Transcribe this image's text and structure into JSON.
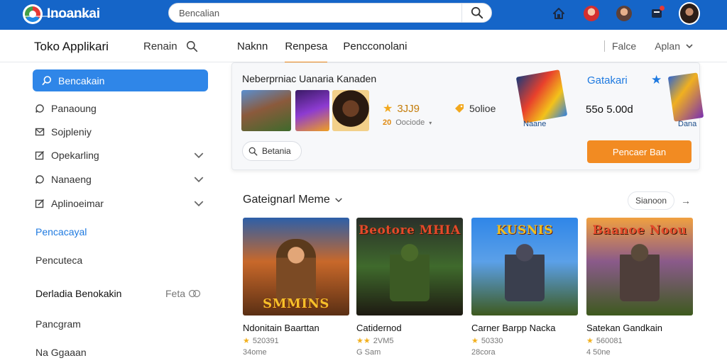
{
  "topbar": {
    "brand": "Inoankai",
    "search_placeholder": "Bencalian",
    "accent": "#1565c8"
  },
  "subbar": {
    "store_title": "Toko Applikari",
    "search_label": "Renain",
    "tabs": [
      {
        "label": "Naknn",
        "active": false
      },
      {
        "label": "Renpesa",
        "active": true
      },
      {
        "label": "Pencconolani",
        "active": false
      }
    ],
    "right_a": "Falce",
    "right_b": "Aplan"
  },
  "sidebar": {
    "active_item": {
      "label": "Bencakain",
      "icon": "search-icon"
    },
    "items": [
      {
        "label": "Panaoung",
        "icon": "chat-icon",
        "has_chevron": false
      },
      {
        "label": "Sojpleniy",
        "icon": "mail-icon",
        "has_chevron": false
      },
      {
        "label": "Opekarling",
        "icon": "edit-icon",
        "has_chevron": true
      },
      {
        "label": "Nanaeng",
        "icon": "chat-icon",
        "has_chevron": true
      },
      {
        "label": "Aplinoeimar",
        "icon": "edit-icon",
        "has_chevron": true
      }
    ],
    "section_blue": "Pencacayal",
    "section_plain": "Pencuteca",
    "row_left": "Derladia Benokakin",
    "row_right": "Feta",
    "tail_1": "Pancgram",
    "tail_2": "Na Ggaaan"
  },
  "feature": {
    "title": "Neberprniac Uanaria Kanaden",
    "rating": "3JJ9",
    "rating_sub_num": "20",
    "rating_sub_label": "Oociode",
    "size": "5olioe",
    "art1_label": "Naane",
    "category": "Gatakari",
    "price": "55o 5.00d",
    "art2_label": "Dana",
    "search_pill": "Betania",
    "cta": "Pencaer Ban"
  },
  "section": {
    "title": "Gateignarl Meme",
    "more": "Sianoon",
    "arrow": "→"
  },
  "cards": [
    {
      "title": "Ndonitain Baarttan",
      "art_word": "SMMINS",
      "rating": "520391",
      "count": "34ome"
    },
    {
      "title": "Catidernod",
      "art_word": "Beotore MHIA",
      "rating": "2VM5",
      "count": "G Sam"
    },
    {
      "title": "Carner Barpp Nacka",
      "art_word": "KUSNIS",
      "rating": "50330",
      "count": "28cora"
    },
    {
      "title": "Satekan Gandkain",
      "art_word": "Baanoe Noou",
      "rating": "560081",
      "count": "4 50ne"
    }
  ]
}
